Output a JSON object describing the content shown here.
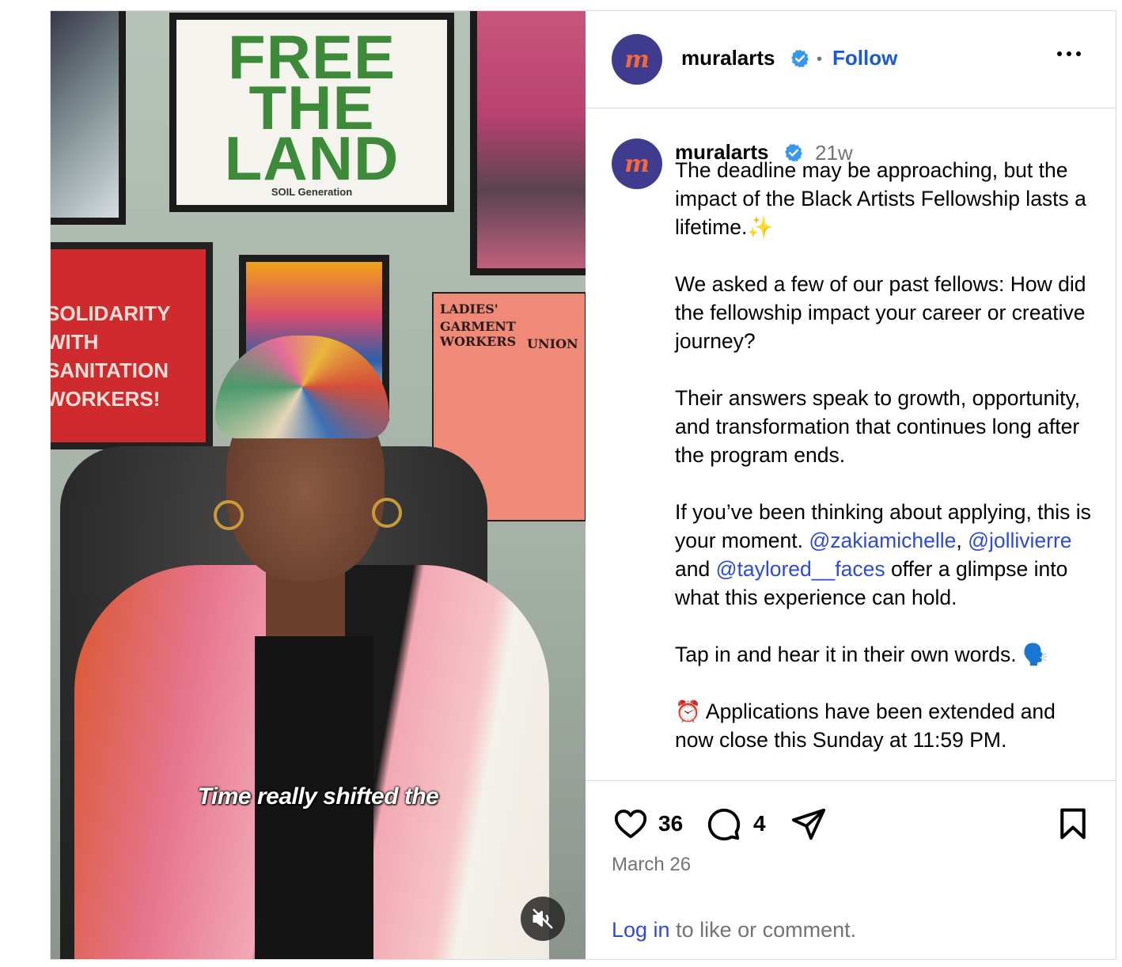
{
  "video": {
    "caption_text": "Time really shifted the",
    "poster_text_top": [
      "FREE",
      "THE",
      "LAND"
    ],
    "poster_free_sub": "SOIL Generation",
    "poster_solidarity": [
      "SOLIDARITY",
      "WITH",
      "SANITATION",
      "WORKERS!"
    ],
    "poster_union": [
      "LADIES'",
      "GARMENT WORKERS",
      "UNION"
    ],
    "mute_icon": "speaker-muted-icon"
  },
  "header": {
    "username": "muralarts",
    "verified_icon": "verified-badge-icon",
    "separator": "•",
    "follow_label": "Follow",
    "more_icon": "more-options-icon",
    "avatar_letter": "m",
    "avatar_bg": "#3f3c8f",
    "avatar_fg": "#f26a3a"
  },
  "post": {
    "username": "muralarts",
    "time_ago": "21w",
    "para1": "The deadline may be approaching, but the impact of the Black Artists Fellowship lasts a lifetime.✨",
    "para2": "We asked a few of our past fellows: How did the fellowship impact your career or creative journey?",
    "para3": "Their answers speak to growth, opportunity, and transformation that continues long after the program ends.",
    "para4_a": "If you’ve been thinking about applying, this is your moment. ",
    "mention1": "@zakiamichelle",
    "para4_b": ",",
    "mention2": "@jollivierre",
    "para4_c": " and ",
    "mention3": "@taylored__faces",
    "para4_d": " offer a glimpse into what this experience can hold.",
    "para5": "Tap in and hear it in their own words. 🗣️",
    "para6": "⏰ Applications have been extended and now close this Sunday at 11:59 PM."
  },
  "actions": {
    "like_icon": "heart-icon",
    "like_count": "36",
    "comment_icon": "comment-icon",
    "comment_count": "4",
    "share_icon": "send-icon",
    "save_icon": "bookmark-icon",
    "date": "March 26",
    "login_link": "Log in",
    "login_rest": " to like or comment."
  },
  "colors": {
    "link": "#2e4bd6",
    "muted_text": "#737373",
    "border": "#dbdbdb",
    "verified": "#3897f0"
  }
}
